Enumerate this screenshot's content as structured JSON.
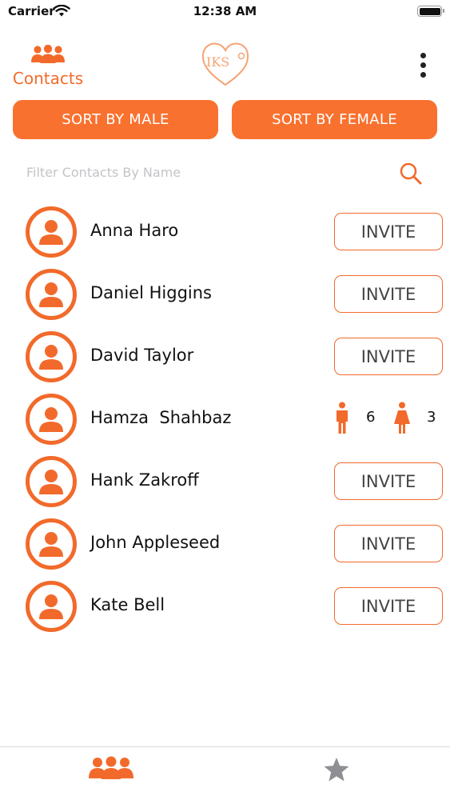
{
  "status_bar": {
    "carrier": "Carrier",
    "time": "12:38 AM"
  },
  "header": {
    "contacts_label": "Contacts",
    "logo_text": "IKS",
    "accent_color": "#F26A2B"
  },
  "sort": {
    "male_label": "SORT BY MALE",
    "female_label": "SORT BY FEMALE"
  },
  "filter": {
    "placeholder": "Filter Contacts By Name",
    "value": ""
  },
  "contacts": [
    {
      "name": "Anna Haro",
      "action": "INVITE"
    },
    {
      "name": "Daniel Higgins",
      "action": "INVITE"
    },
    {
      "name": "David Taylor",
      "action": "INVITE"
    },
    {
      "name": "Hamza  Shahbaz",
      "male_count": "6",
      "female_count": "3"
    },
    {
      "name": "Hank Zakroff",
      "action": "INVITE"
    },
    {
      "name": "John Appleseed",
      "action": "INVITE"
    },
    {
      "name": "Kate Bell",
      "action": "INVITE"
    }
  ],
  "tab_bar": {
    "tabs": [
      {
        "icon": "people-icon",
        "active": true
      },
      {
        "icon": "star-icon",
        "active": false
      }
    ]
  }
}
